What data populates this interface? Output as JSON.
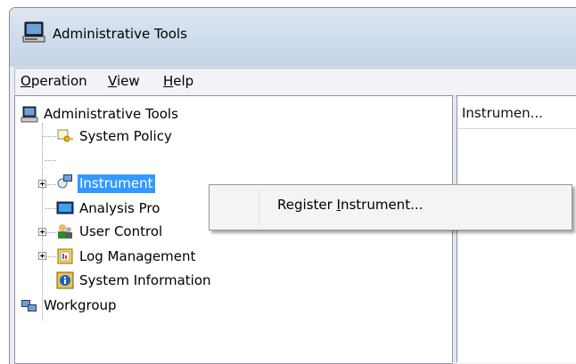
{
  "window": {
    "title": "Administrative Tools"
  },
  "menubar": {
    "items": [
      {
        "pre": "",
        "mnemonic": "O",
        "post": "peration"
      },
      {
        "pre": "",
        "mnemonic": "V",
        "post": "iew"
      },
      {
        "pre": "",
        "mnemonic": "H",
        "post": "elp"
      }
    ]
  },
  "tree": {
    "root": {
      "label": "Administrative Tools",
      "icon": "computer-icon"
    },
    "children": [
      {
        "label": "System Policy",
        "icon": "key-policy-icon"
      },
      {
        "label": "Instrument",
        "icon": "instrument-network-icon",
        "selected": true,
        "expandable": true
      },
      {
        "label": "Analysis Pro",
        "icon": "monitor-icon"
      },
      {
        "label": "User Control",
        "icon": "users-icon",
        "expandable": true
      },
      {
        "label": "Log Management",
        "icon": "log-folder-icon",
        "expandable": true
      },
      {
        "label": "System Information",
        "icon": "info-icon"
      }
    ],
    "sibling": {
      "label": "Workgroup",
      "icon": "workgroup-icon"
    }
  },
  "listview": {
    "column_header": "Instrumen..."
  },
  "context_menu": {
    "item": {
      "pre": "Register ",
      "mnemonic": "I",
      "post": "nstrument..."
    }
  }
}
